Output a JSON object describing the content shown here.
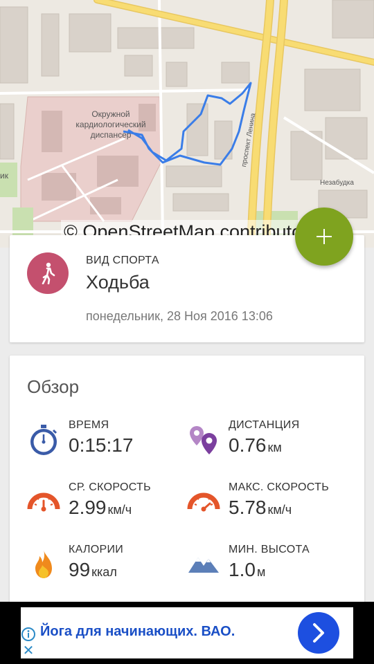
{
  "map": {
    "labels": {
      "hospital": "Окружной кардиологический диспансер",
      "street": "проспект Ленина",
      "district": "Незабудка",
      "left_edge": "ик"
    },
    "credit": "© OpenStreetMap contributors",
    "route_color": "#3a7de8"
  },
  "fab": {
    "icon": "plus-icon",
    "color": "#7fa31f"
  },
  "activity": {
    "sport_label": "ВИД СПОРТА",
    "sport_name": "Ходьба",
    "date": "понедельник, 28 Ноя 2016 13:06",
    "icon": "walking-person-icon",
    "accent": "#c4506e"
  },
  "overview": {
    "title": "Обзор",
    "stats": [
      {
        "label": "ВРЕМЯ",
        "value": "0:15:17",
        "unit": "",
        "icon": "stopwatch-icon"
      },
      {
        "label": "ДИСТАНЦИЯ",
        "value": "0.76",
        "unit": "км",
        "icon": "map-pins-icon"
      },
      {
        "label": "СР. СКОРОСТЬ",
        "value": "2.99",
        "unit": "км/ч",
        "icon": "speedometer-icon"
      },
      {
        "label": "МАКС. СКОРОСТЬ",
        "value": "5.78",
        "unit": "км/ч",
        "icon": "speedometer-max-icon"
      },
      {
        "label": "КАЛОРИИ",
        "value": "99",
        "unit": "ккал",
        "icon": "flame-icon"
      },
      {
        "label": "МИН. ВЫСОТА",
        "value": "1.0",
        "unit": "м",
        "icon": "mountains-icon"
      }
    ]
  },
  "ad": {
    "text": "Йога для начинающих. ВАО.",
    "go_icon": "chevron-right-icon",
    "info_icon": "info-icon",
    "close_icon": "close-icon",
    "close_glyph": "✕"
  }
}
